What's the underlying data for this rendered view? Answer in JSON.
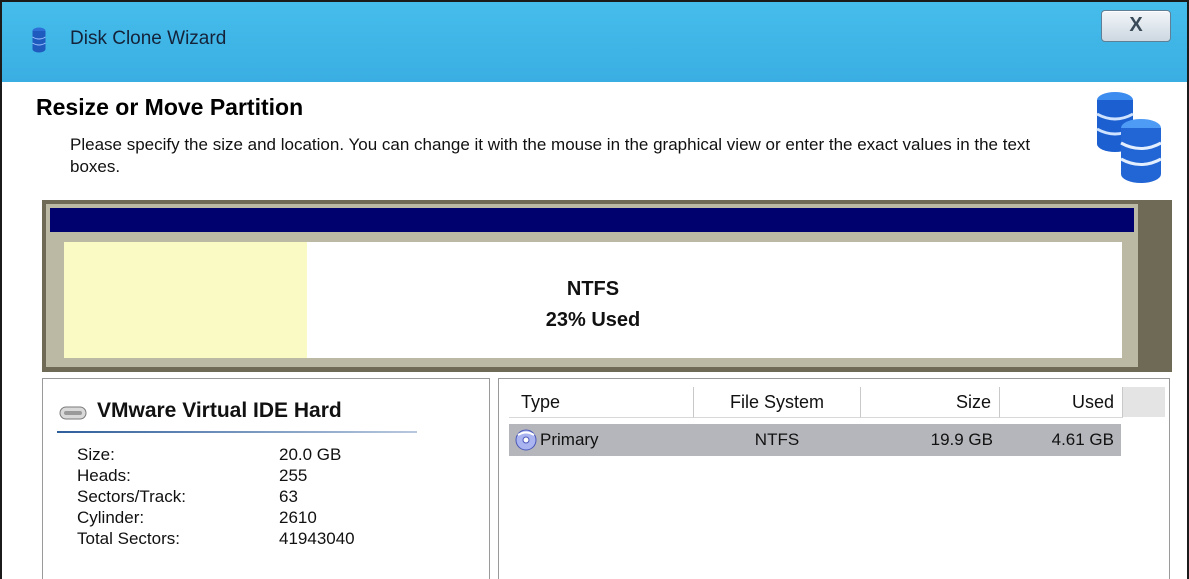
{
  "window": {
    "title": "Disk Clone Wizard",
    "close_label": "X"
  },
  "header": {
    "title": "Resize or Move Partition",
    "description": "Please specify the size and location. You can change it with the mouse in the graphical view or enter the exact values in the text boxes."
  },
  "partition_map": {
    "file_system": "NTFS",
    "used_label": "23% Used",
    "used_fraction": 0.23
  },
  "disk": {
    "name": "VMware Virtual IDE Hard",
    "properties": [
      {
        "label": "Size:",
        "value": "20.0 GB"
      },
      {
        "label": "Heads:",
        "value": "255"
      },
      {
        "label": "Sectors/Track:",
        "value": "63"
      },
      {
        "label": "Cylinder:",
        "value": "2610"
      },
      {
        "label": "Total Sectors:",
        "value": "41943040"
      }
    ]
  },
  "partition_table": {
    "columns": [
      "Type",
      "File System",
      "Size",
      "Used"
    ],
    "rows": [
      {
        "type": "Primary",
        "file_system": "NTFS",
        "size": "19.9 GB",
        "used": "4.61 GB"
      }
    ]
  },
  "colors": {
    "titlebar": "#3aaee2",
    "partition_bar": "#00006e",
    "used_fill": "#fafac4",
    "selected_row": "#b5b6bb"
  },
  "icons": {
    "title": "database-icon",
    "header": "stacked-databases-icon",
    "disk": "hard-disk-icon",
    "partition": "primary-partition-icon"
  }
}
